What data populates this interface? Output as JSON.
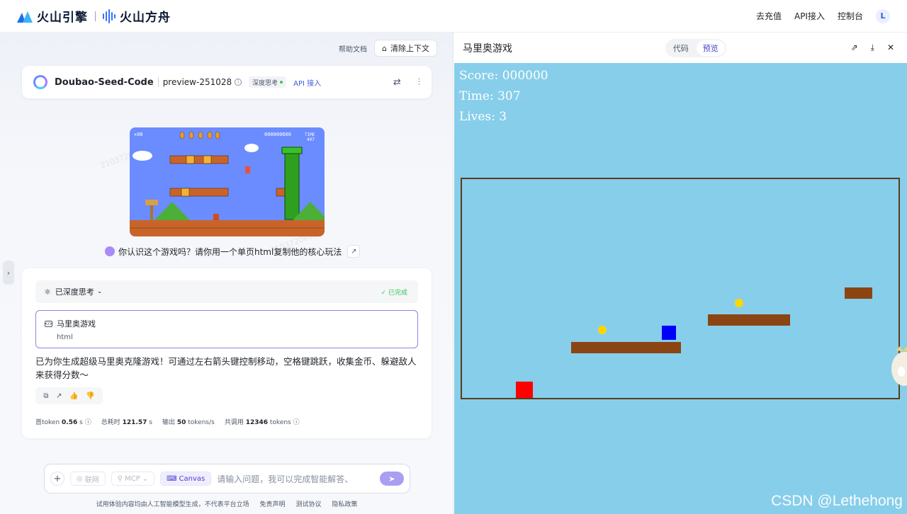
{
  "header": {
    "brand_left": "火山引擎",
    "brand_right": "火山方舟",
    "links": [
      "去充值",
      "API接入",
      "控制台"
    ],
    "avatar": "L"
  },
  "left": {
    "help_link": "帮助文档",
    "clear_btn": "清除上下文",
    "model": {
      "name": "Doubao-Seed-Code",
      "version": "preview-251028",
      "info": "i",
      "think_badge": "深度思考",
      "api_link": "API 接入"
    },
    "user_question": "你认识这个游戏吗？请你用一个单页html复制他的核心玩法",
    "thumb": {
      "lives": "✕00",
      "score": "000000600",
      "time_label": "TIME",
      "time_value": "497"
    },
    "answer": {
      "think_label": "已深度思考",
      "status": "已完成",
      "artifact_title": "马里奥游戏",
      "artifact_sub": "html",
      "text": "已为你生成超级马里奥克隆游戏！可通过左右箭头键控制移动，空格键跳跃，收集金币、躲避敌人来获得分数～",
      "stats": [
        {
          "label": "首token",
          "value": "0.56",
          "unit": "s"
        },
        {
          "label": "总耗时",
          "value": "121.57",
          "unit": "s"
        },
        {
          "label": "输出",
          "value": "50",
          "unit": "tokens/s"
        },
        {
          "label": "共调用",
          "value": "12346",
          "unit": "tokens"
        }
      ]
    },
    "input": {
      "chips": [
        "联网",
        "MCP",
        "Canvas"
      ],
      "placeholder": "请输入问题，我可以完成智能解答、"
    },
    "footer": [
      "试用体验内容均由人工智能模型生成，不代表平台立场",
      "免责声明",
      "测试协议",
      "隐私政策"
    ]
  },
  "right": {
    "title": "马里奥游戏",
    "tabs": [
      "代码",
      "预览"
    ],
    "active_tab": "预览",
    "game": {
      "score": "Score: 000000",
      "time": "Time: 307",
      "lives": "Lives: 3"
    },
    "watermark": "CSDN @Lethehong"
  },
  "colors": {
    "accent": "#4a3fd0",
    "sky": "#87ceea",
    "platform": "#8b4513",
    "coin": "#ffd700",
    "player": "#ff0000",
    "enemy": "#0000ff"
  }
}
